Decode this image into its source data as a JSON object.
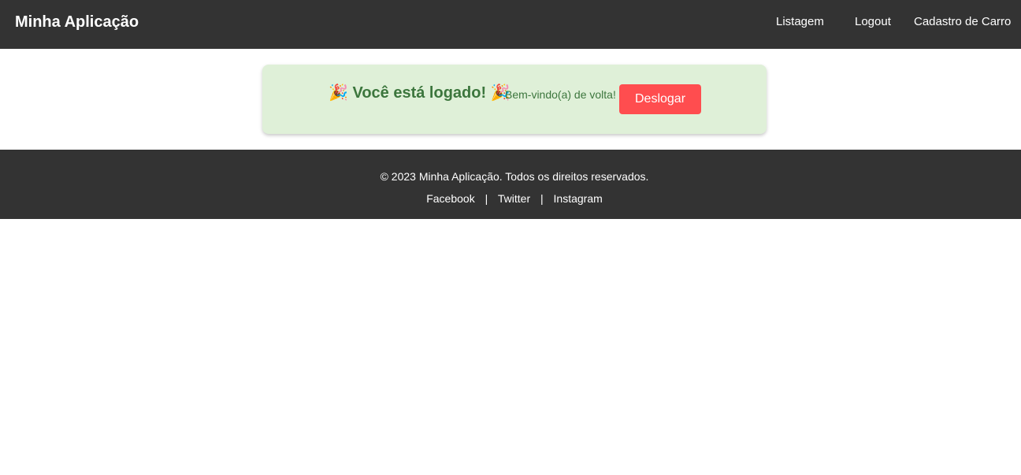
{
  "header": {
    "brand": "Minha Aplicação",
    "nav": {
      "listagem": "Listagem",
      "logout": "Logout",
      "cadastro": "Cadastro de Carro"
    }
  },
  "main": {
    "title_icon": "🎉",
    "title": "Você está logado!",
    "subtitle": "Bem-vindo(a) de volta!",
    "logout_button": "Deslogar",
    "card_color": "#dff0d8",
    "text_color": "#3c763d",
    "button_color": "#ff4d4f"
  },
  "footer": {
    "copyright": "© 2023 Minha Aplicação. Todos os direitos reservados.",
    "links": {
      "facebook": "Facebook",
      "twitter": "Twitter",
      "instagram": "Instagram"
    },
    "separator": "|"
  },
  "icons": {
    "party": "party-popper-icon"
  }
}
